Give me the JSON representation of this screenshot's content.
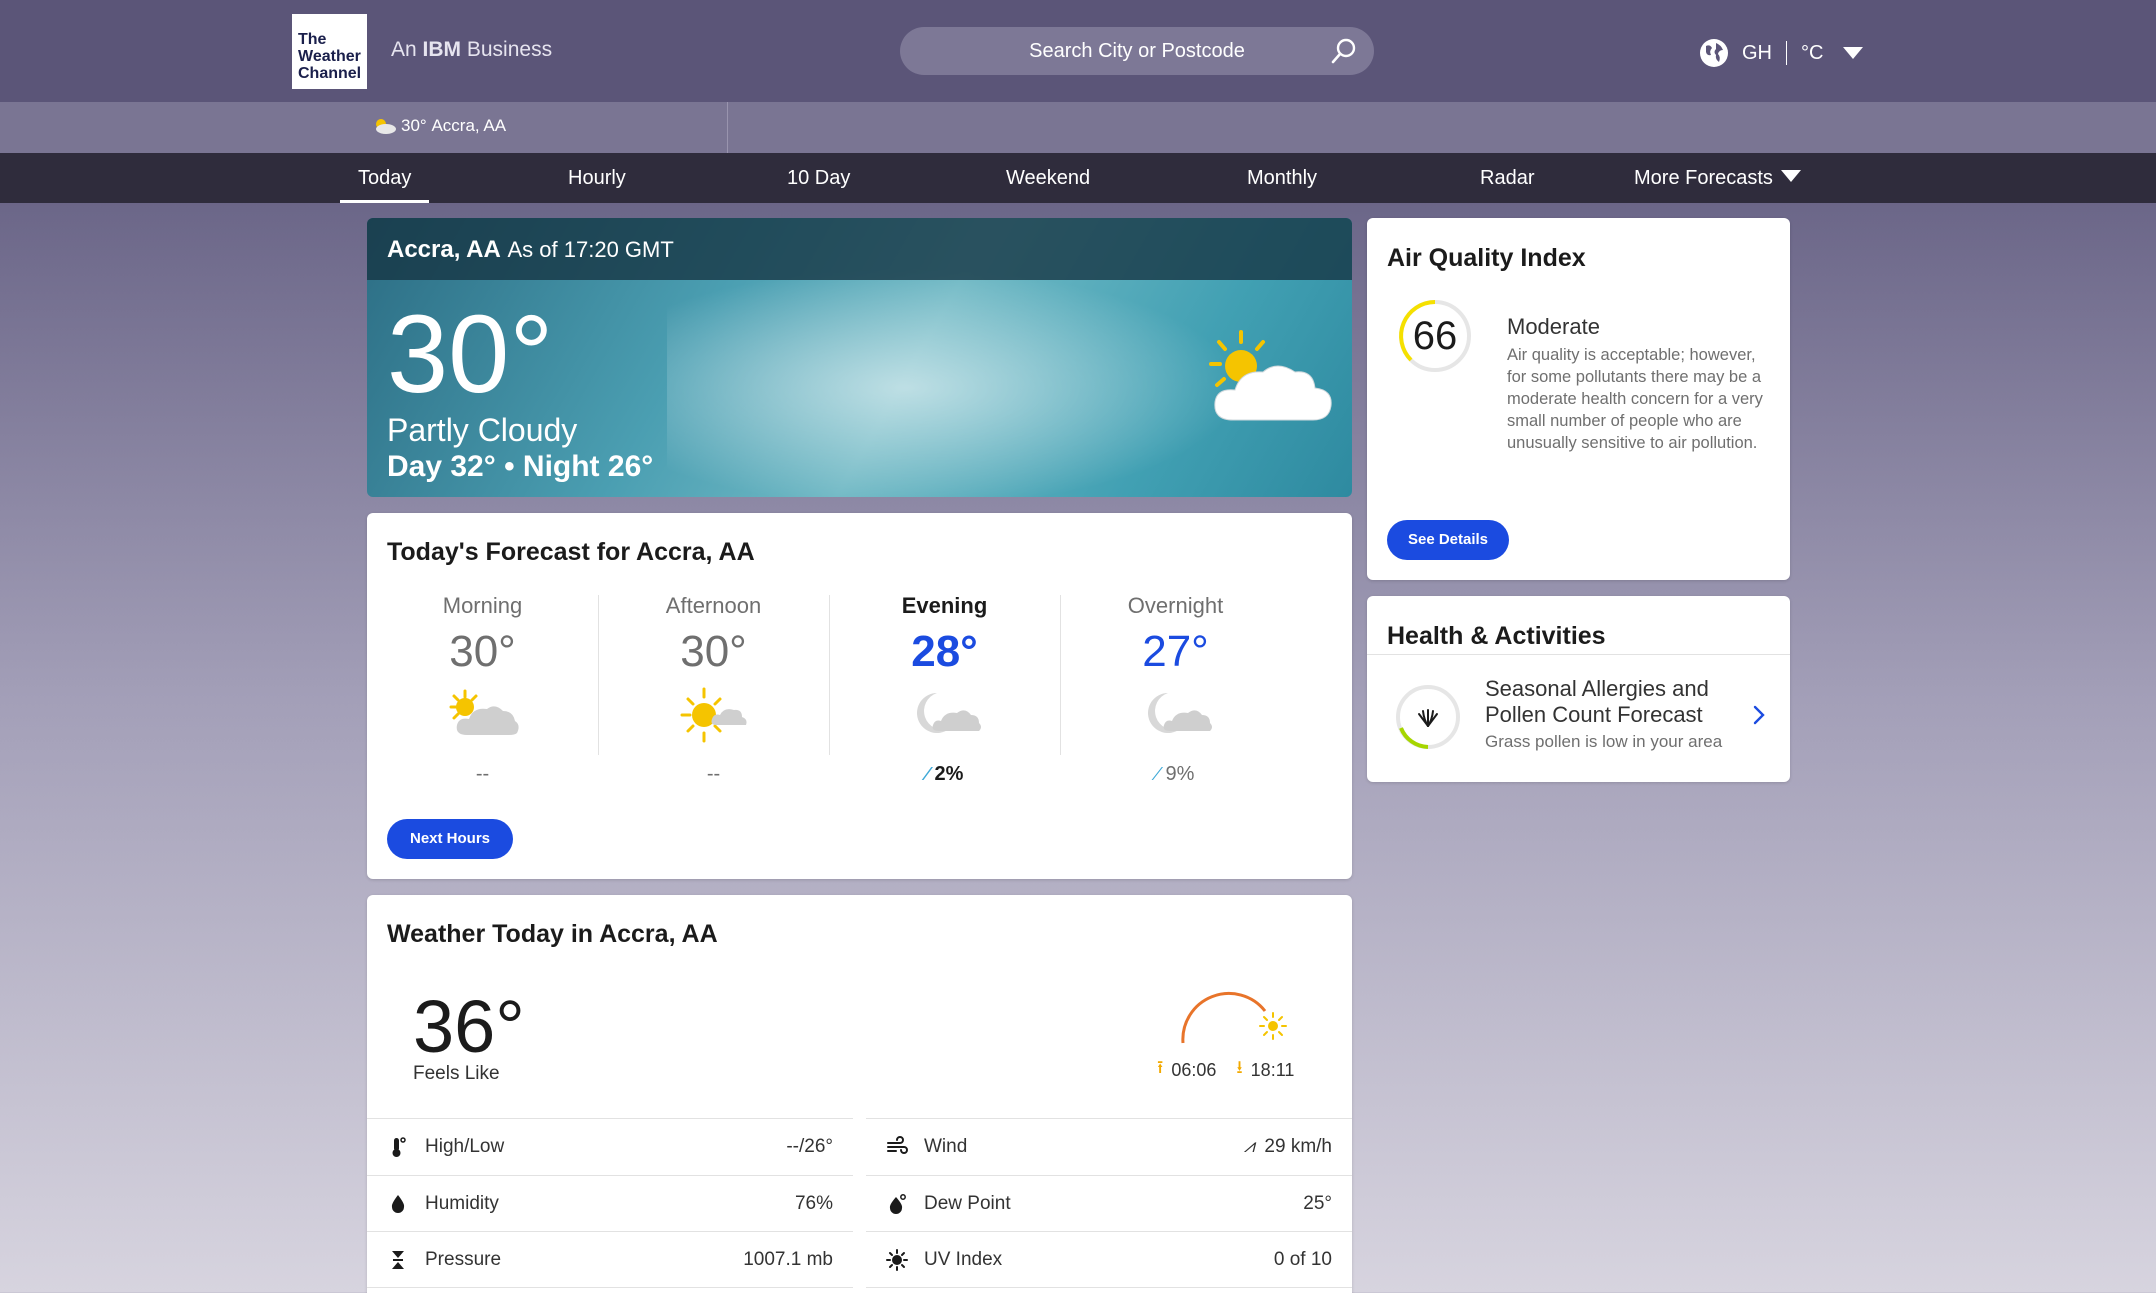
{
  "header": {
    "logo_line1": "The",
    "logo_line2": "Weather",
    "logo_line3": "Channel",
    "tagline_prefix": "An",
    "tagline_brand": "IBM",
    "tagline_suffix": "Business",
    "search_placeholder": "Search City or Postcode",
    "region": "GH",
    "unit": "°C"
  },
  "subbar": {
    "location_temp": "30°",
    "location_name": "Accra, AA"
  },
  "nav": {
    "items": [
      "Today",
      "Hourly",
      "10 Day",
      "Weekend",
      "Monthly",
      "Radar",
      "More Forecasts"
    ],
    "active": "Today"
  },
  "current": {
    "city": "Accra, AA",
    "as_of": "As of 17:20 GMT",
    "temp": "30°",
    "phrase": "Partly Cloudy",
    "day_night": "Day 32° • Night 26°",
    "icon": "partly-cloudy-day-icon"
  },
  "forecast": {
    "title": "Today's Forecast for Accra, AA",
    "periods": [
      {
        "name": "Morning",
        "temp": "30°",
        "icon": "partly-cloudy-day-icon",
        "precip": "--"
      },
      {
        "name": "Afternoon",
        "temp": "30°",
        "icon": "mostly-sunny-icon",
        "precip": "--"
      },
      {
        "name": "Evening",
        "temp": "28°",
        "icon": "partly-cloudy-night-icon",
        "precip": "2%"
      },
      {
        "name": "Overnight",
        "temp": "27°",
        "icon": "partly-cloudy-night-icon",
        "precip": "9%"
      }
    ],
    "button": "Next Hours"
  },
  "today": {
    "title": "Weather Today in Accra, AA",
    "feels_like_value": "36°",
    "feels_like_label": "Feels Like",
    "sunrise": "06:06",
    "sunset": "18:11",
    "details": [
      {
        "label": "High/Low",
        "value": "--/26°",
        "icon": "thermometer-icon"
      },
      {
        "label": "Wind",
        "value": "29 km/h",
        "icon": "wind-icon"
      },
      {
        "label": "Humidity",
        "value": "76%",
        "icon": "humidity-drop-icon"
      },
      {
        "label": "Dew Point",
        "value": "25°",
        "icon": "dew-point-icon"
      },
      {
        "label": "Pressure",
        "value": "1007.1 mb",
        "icon": "pressure-icon"
      },
      {
        "label": "UV Index",
        "value": "0 of 10",
        "icon": "uv-sun-icon"
      }
    ]
  },
  "aqi": {
    "title": "Air Quality Index",
    "value": "66",
    "category": "Moderate",
    "description": "Air quality is acceptable; however, for some pollutants there may be a moderate health concern for a very small number of people who are unusually sensitive to air pollution.",
    "button": "See Details",
    "accent": "#f5e000"
  },
  "health": {
    "title": "Health & Activities",
    "item_title": "Seasonal Allergies and Pollen Count Forecast",
    "item_sub": "Grass pollen is low in your area"
  },
  "colors": {
    "header_bg": "#5b5578",
    "nav_bg": "#2f2c3c",
    "accent_blue": "#1b4be0"
  }
}
